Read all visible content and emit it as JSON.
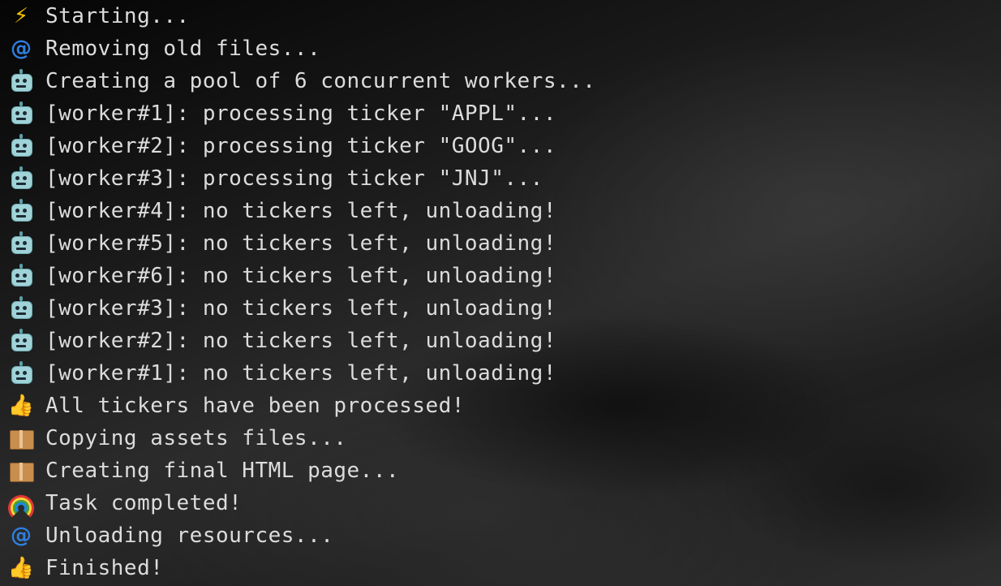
{
  "terminal": {
    "lines": [
      {
        "icon": "lightning-icon",
        "text": "Starting..."
      },
      {
        "icon": "cyclone-icon",
        "text": "Removing old files..."
      },
      {
        "icon": "robot-icon",
        "text": "Creating a pool of 6 concurrent workers..."
      },
      {
        "icon": "robot-icon",
        "text": "[worker#1]: processing ticker \"APPL\"..."
      },
      {
        "icon": "robot-icon",
        "text": "[worker#2]: processing ticker \"GOOG\"..."
      },
      {
        "icon": "robot-icon",
        "text": "[worker#3]: processing ticker \"JNJ\"..."
      },
      {
        "icon": "robot-icon",
        "text": "[worker#4]: no tickers left, unloading!"
      },
      {
        "icon": "robot-icon",
        "text": "[worker#5]: no tickers left, unloading!"
      },
      {
        "icon": "robot-icon",
        "text": "[worker#6]: no tickers left, unloading!"
      },
      {
        "icon": "robot-icon",
        "text": "[worker#3]: no tickers left, unloading!"
      },
      {
        "icon": "robot-icon",
        "text": "[worker#2]: no tickers left, unloading!"
      },
      {
        "icon": "robot-icon",
        "text": "[worker#1]: no tickers left, unloading!"
      },
      {
        "icon": "thumbs-up-icon",
        "text": "All tickers have been processed!"
      },
      {
        "icon": "package-icon",
        "text": "Copying assets files..."
      },
      {
        "icon": "package-icon",
        "text": "Creating final HTML page..."
      },
      {
        "icon": "rainbow-icon",
        "text": "Task completed!"
      },
      {
        "icon": "cyclone-icon",
        "text": "Unloading resources..."
      },
      {
        "icon": "thumbs-up-icon",
        "text": "Finished!"
      }
    ]
  },
  "colors": {
    "text": "#dcdcdc",
    "background": "#1e1e1e"
  }
}
